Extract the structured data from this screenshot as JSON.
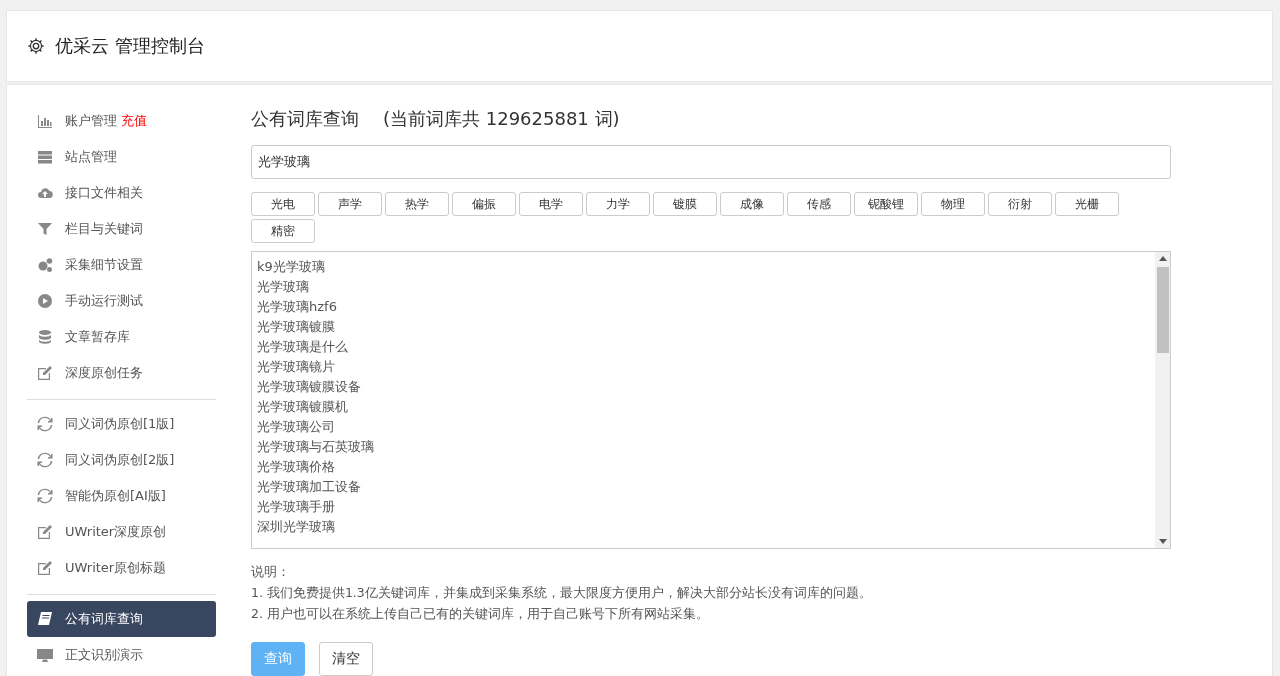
{
  "header": {
    "title": "优采云 管理控制台"
  },
  "sidebar": {
    "groups": [
      [
        {
          "label": "账户管理",
          "badge": "充值",
          "kind": "chart",
          "selected": false
        },
        {
          "label": "站点管理",
          "kind": "server",
          "selected": false
        },
        {
          "label": "接口文件相关",
          "kind": "cloud",
          "selected": false
        },
        {
          "label": "栏目与关键词",
          "kind": "filter",
          "selected": false
        },
        {
          "label": "采集细节设置",
          "kind": "gears",
          "selected": false
        },
        {
          "label": "手动运行测试",
          "kind": "play",
          "selected": false
        },
        {
          "label": "文章暂存库",
          "kind": "database",
          "selected": false
        },
        {
          "label": "深度原创任务",
          "kind": "edit",
          "selected": false
        }
      ],
      [
        {
          "label": "同义词伪原创[1版]",
          "kind": "refresh",
          "selected": false
        },
        {
          "label": "同义词伪原创[2版]",
          "kind": "refresh",
          "selected": false
        },
        {
          "label": "智能伪原创[AI版]",
          "kind": "refresh",
          "selected": false
        },
        {
          "label": "UWriter深度原创",
          "kind": "edit",
          "selected": false
        },
        {
          "label": "UWriter原创标题",
          "kind": "edit",
          "selected": false
        }
      ],
      [
        {
          "label": "公有词库查询",
          "kind": "book",
          "selected": true
        },
        {
          "label": "正文识别演示",
          "kind": "monitor",
          "selected": false
        }
      ]
    ]
  },
  "main": {
    "title": "公有词库查询",
    "subtitle": "(当前词库共 129625881 词)",
    "search": {
      "value": "光学玻璃"
    },
    "tags": [
      "光电",
      "声学",
      "热学",
      "偏振",
      "电学",
      "力学",
      "镀膜",
      "成像",
      "传感",
      "铌酸锂",
      "物理",
      "衍射",
      "光栅",
      "精密"
    ],
    "results": [
      "k9光学玻璃",
      "光学玻璃",
      "光学玻璃hzf6",
      "光学玻璃镀膜",
      "光学玻璃是什么",
      "光学玻璃镜片",
      "光学玻璃镀膜设备",
      "光学玻璃镀膜机",
      "光学玻璃公司",
      "光学玻璃与石英玻璃",
      "光学玻璃价格",
      "光学玻璃加工设备",
      "光学玻璃手册",
      "深圳光学玻璃"
    ],
    "notes": [
      "说明：",
      "1. 我们免费提供1.3亿关键词库，并集成到采集系统，最大限度方便用户，解决大部分站长没有词库的问题。",
      "2. 用户也可以在系统上传自己已有的关键词库，用于自己账号下所有网站采集。"
    ],
    "buttons": [
      {
        "label": "查询",
        "kind": "primary"
      },
      {
        "label": "清空",
        "kind": "default"
      }
    ]
  }
}
